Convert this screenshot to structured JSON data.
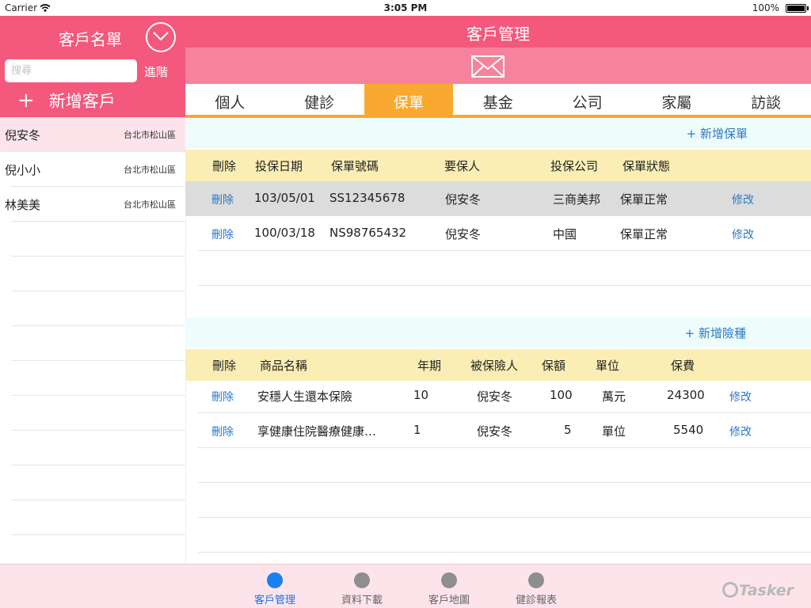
{
  "status_bar": {
    "carrier": "Carrier",
    "time": "3:05 PM",
    "battery": "100%"
  },
  "sidebar": {
    "title": "客戶名單",
    "search_placeholder": "搜尋",
    "advanced_label": "進階",
    "add_label": "新增客戶",
    "add_icon": "+",
    "customers": [
      {
        "name": "倪安冬",
        "area": "台北市松山區",
        "selected": true
      },
      {
        "name": "倪小小",
        "area": "台北市松山區",
        "selected": false
      },
      {
        "name": "林美美",
        "area": "台北市松山區",
        "selected": false
      }
    ]
  },
  "header": {
    "title": "客戶管理"
  },
  "tabs": [
    "個人",
    "健診",
    "保單",
    "基金",
    "公司",
    "家屬",
    "訪談"
  ],
  "active_tab": "保單",
  "policies": {
    "add_label": "+ 新增保單",
    "columns": [
      "刪除",
      "投保日期",
      "保單號碼",
      "要保人",
      "投保公司",
      "保單狀態"
    ],
    "rows": [
      {
        "delete": "刪除",
        "date": "103/05/01",
        "number": "SS12345678",
        "holder": "倪安冬",
        "company": "三商美邦",
        "status": "保單正常",
        "edit": "修改"
      },
      {
        "delete": "刪除",
        "date": "100/03/18",
        "number": "NS98765432",
        "holder": "倪安冬",
        "company": "中國",
        "status": "保單正常",
        "edit": "修改"
      }
    ]
  },
  "coverages": {
    "add_label": "+ 新增險種",
    "columns": [
      "刪除",
      "商品名稱",
      "年期",
      "被保險人",
      "保額",
      "單位",
      "保費"
    ],
    "rows": [
      {
        "delete": "刪除",
        "product": "安穩人生還本保險",
        "term": "10",
        "insured": "倪安冬",
        "amount": "100",
        "unit": "萬元",
        "premium": "24300",
        "edit": "修改"
      },
      {
        "delete": "刪除",
        "product": "享健康住院醫療健康…",
        "term": "1",
        "insured": "倪安冬",
        "amount": "5",
        "unit": "單位",
        "premium": "5540",
        "edit": "修改"
      }
    ]
  },
  "tabbar": {
    "items": [
      "客戶管理",
      "資料下載",
      "客戶地圖",
      "健診報表"
    ],
    "active": "客戶管理",
    "logo": "Tasker"
  },
  "colors": {
    "accent": "#f4587c",
    "tab_active": "#f9a930",
    "link": "#2a78c9",
    "header_row": "#fbeeb4"
  }
}
